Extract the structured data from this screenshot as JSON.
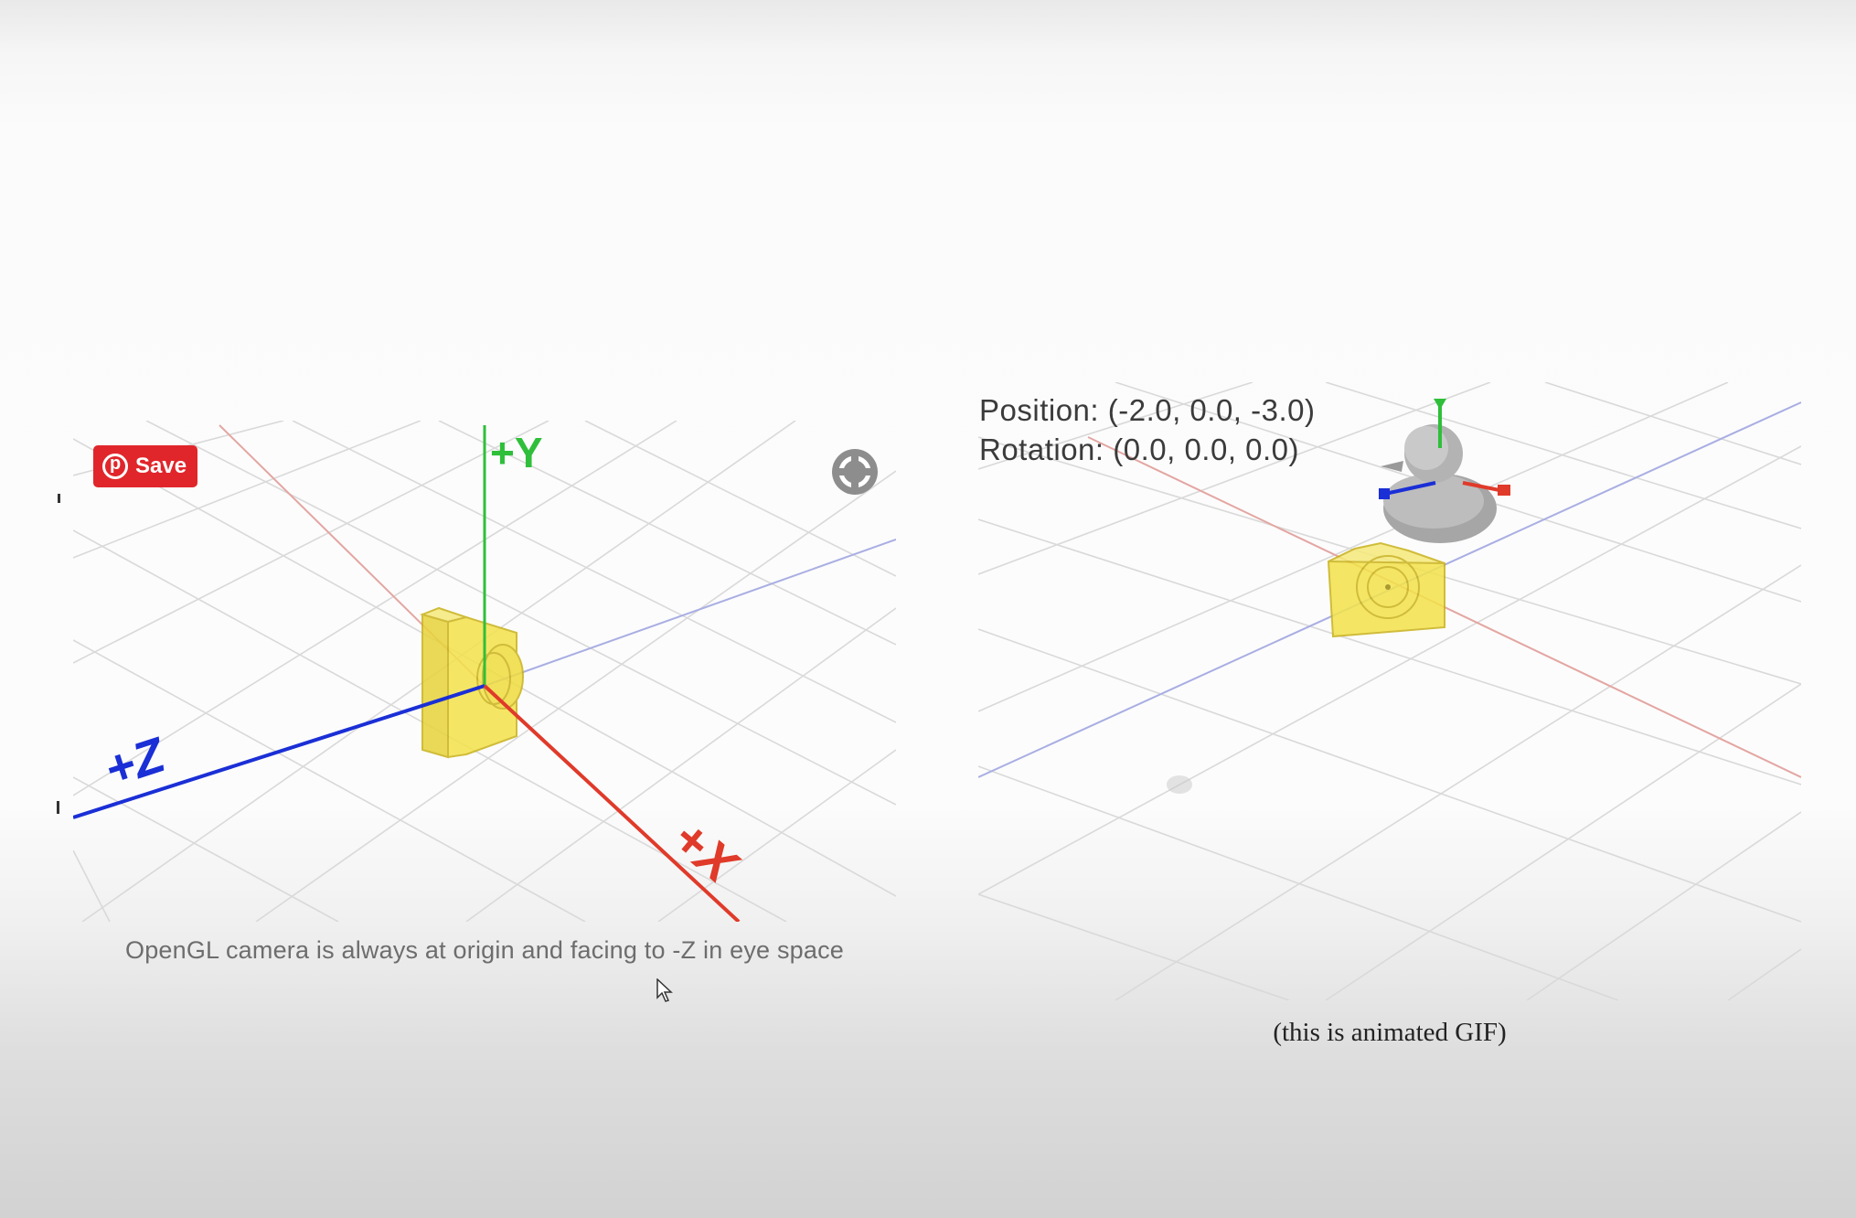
{
  "left_figure": {
    "save_button_label": "Save",
    "axis_labels": {
      "y": "+Y",
      "z": "+Z",
      "x": "+X"
    },
    "caption": "OpenGL camera is always at origin and facing to -Z in eye space",
    "icons": [
      "pinterest-icon",
      "fullscreen-target-icon",
      "camera-model-icon",
      "mouse-cursor-icon"
    ],
    "colors": {
      "x_axis": "#e03a2a",
      "y_axis": "#2fbf3a",
      "z_axis": "#1a2fd6",
      "camera": "#f3e34a",
      "save_button": "#e0262b"
    }
  },
  "right_figure": {
    "position_text": "Position: (-2.0, 0.0, -3.0)",
    "rotation_text": "Rotation: (0.0, 0.0, 0.0)",
    "caption": "(this is animated GIF)",
    "icons": [
      "duck-model-icon",
      "camera-model-icon"
    ]
  }
}
